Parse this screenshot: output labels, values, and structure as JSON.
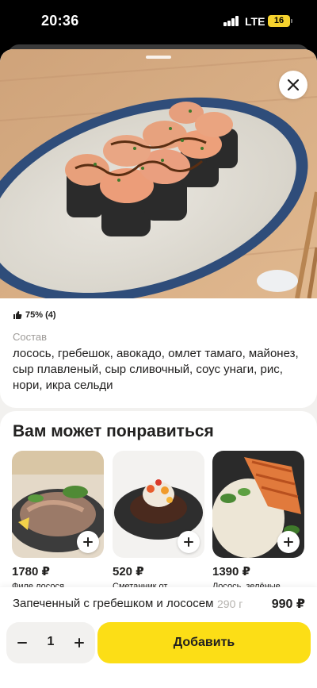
{
  "status_bar": {
    "time": "20:36",
    "network": "LTE",
    "battery": "16"
  },
  "product": {
    "rating": "75% (4)",
    "composition_label": "Состав",
    "composition": "лосось, гребешок, авокадо, омлет тамаго, майонез, сыр плавленый, сыр сливочный, соус унаги, рис, нори, икра сельди",
    "name": "Запеченный с гребешком и лососем",
    "weight": "290 г",
    "price": "990 ₽"
  },
  "recommendations": {
    "title": "Вам может понравиться",
    "items": [
      {
        "price": "1780 ₽",
        "name": "Филе лосося"
      },
      {
        "price": "520 ₽",
        "name": "Сметанник от"
      },
      {
        "price": "1390 ₽",
        "name": "Лосось, зелёные"
      }
    ]
  },
  "cart": {
    "quantity": "1",
    "add_label": "Добавить"
  },
  "colors": {
    "accent": "#fcde16",
    "background": "#f2f1ef"
  },
  "icons": [
    "close-icon",
    "thumbs-up-icon",
    "plus-icon",
    "minus-icon"
  ]
}
